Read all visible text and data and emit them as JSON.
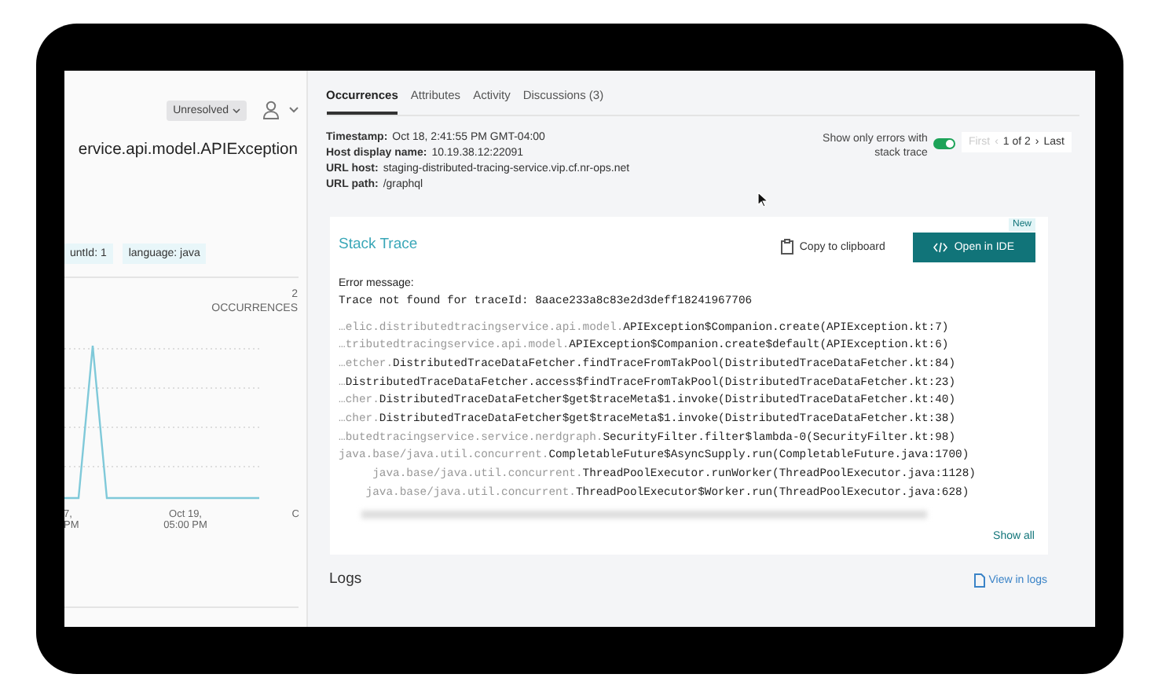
{
  "left_panel": {
    "status_button": "Unresolved",
    "title": "ervice.api.model.APIException",
    "tags": [
      "untId: 1",
      "language: java"
    ],
    "occurrences": {
      "count": "2",
      "label": "OCCURRENCES"
    },
    "chart": {
      "x_labels": [
        "7,\nPM",
        "Oct 19,\n05:00 PM",
        "C"
      ]
    }
  },
  "tabs": [
    {
      "label": "Occurrences",
      "selected": true
    },
    {
      "label": "Attributes",
      "selected": false
    },
    {
      "label": "Activity",
      "selected": false
    },
    {
      "label": "Discussions (3)",
      "selected": false
    }
  ],
  "details": [
    {
      "key": "Timestamp:",
      "value": "Oct 18, 2:41:55 PM GMT-04:00"
    },
    {
      "key": "Host display name:",
      "value": "10.19.38.12:22091"
    },
    {
      "key": "URL host:",
      "value": "staging-distributed-tracing-service.vip.cf.nr-ops.net"
    },
    {
      "key": "URL path:",
      "value": "/graphql"
    }
  ],
  "filter": {
    "label": "Show only errors with stack trace",
    "on": true
  },
  "pager": {
    "first": "First",
    "first_disabled": true,
    "prev": "‹",
    "position": "1 of 2",
    "next": "›",
    "last": "Last"
  },
  "stack_trace": {
    "title": "Stack Trace",
    "copy": "Copy to clipboard",
    "open_ide": "Open in IDE",
    "badge": "New",
    "error_label": "Error message:",
    "error_message": "Trace not found for traceId: 8aace233a8c83e2d3deff18241967706",
    "lines": [
      {
        "dim": "…elic.distributedtracingservice.api.model.",
        "main": "APIException$Companion.create(APIException.kt:7)"
      },
      {
        "dim": "…tributedtracingservice.api.model.",
        "main": "APIException$Companion.create$default(APIException.kt:6)"
      },
      {
        "dim": "…etcher.",
        "main": "DistributedTraceDataFetcher.findTraceFromTakPool(DistributedTraceDataFetcher.kt:84)"
      },
      {
        "dim": "…",
        "main": "DistributedTraceDataFetcher.access$findTraceFromTakPool(DistributedTraceDataFetcher.kt:23)"
      },
      {
        "dim": "…cher.",
        "main": "DistributedTraceDataFetcher$get$traceMeta$1.invoke(DistributedTraceDataFetcher.kt:40)"
      },
      {
        "dim": "…cher.",
        "main": "DistributedTraceDataFetcher$get$traceMeta$1.invoke(DistributedTraceDataFetcher.kt:38)"
      },
      {
        "dim": "…butedtracingservice.service.nerdgraph.",
        "main": "SecurityFilter.filter$lambda-0(SecurityFilter.kt:98)"
      },
      {
        "dim": "java.base/java.util.concurrent.",
        "main": "CompletableFuture$AsyncSupply.run(CompletableFuture.java:1700)"
      },
      {
        "dim": "     java.base/java.util.concurrent.",
        "main": "ThreadPoolExecutor.runWorker(ThreadPoolExecutor.java:1128)"
      },
      {
        "dim": "    java.base/java.util.concurrent.",
        "main": "ThreadPoolExecutor$Worker.run(ThreadPoolExecutor.java:628)"
      }
    ],
    "show_all": "Show all"
  },
  "logs": {
    "title": "Logs",
    "link": "View in logs"
  }
}
